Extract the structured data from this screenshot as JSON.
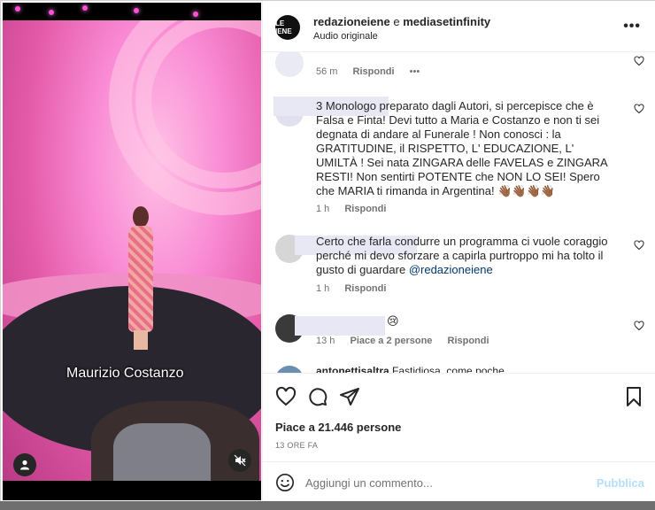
{
  "video": {
    "caption": "Maurizio Costanzo",
    "user_icon": "user-icon",
    "mute_icon": "muted-icon"
  },
  "header": {
    "account1": "redazioneiene",
    "joiner": "e",
    "account2": "mediasetinfinity",
    "subtitle": "Audio originale",
    "avatar_text": "LE IENE"
  },
  "comments": [
    {
      "text": "",
      "meta": [
        "56 m",
        "Rispondi",
        "•••"
      ]
    },
    {
      "text": "3 Monologo preparato dagli Autori, si percepisce che è Falsa e Finta! Devi tutto a Maria e Costanzo e non ti sei degnata di andare al Funerale ! Non conosci : la GRATITUDINE, il RISPETTO, L' EDUCAZIONE, L' UMILTÀ ! Sei nata ZINGARA delle FAVELAS e ZINGARA RESTI! Non sentirti POTENTE che NON LO SEI! Spero che MARIA ti rimanda in Argentina! 👋🏾👋🏾👋🏾👋🏾",
      "meta": [
        "1 h",
        "Rispondi"
      ]
    },
    {
      "text": "Certo che farla condurre un programma ci vuole coraggio perché mi devo sforzare a capirla purtroppo mi ha tolto il gusto di guardare",
      "mention": "@redazioneiene",
      "meta": [
        "1 h",
        "Rispondi"
      ]
    },
    {
      "text": "😢",
      "meta": [
        "13 h",
        "Piace a 2 persone",
        "Rispondi"
      ]
    },
    {
      "text": "Fastidiosa, come poche",
      "user": "antonettisaltra"
    }
  ],
  "actions": {
    "likes": "Piace a 21.446 persone",
    "time": "13 ORE FA"
  },
  "composer": {
    "placeholder": "Aggiungi un commento...",
    "publish": "Pubblica"
  },
  "colors": {
    "link": "#00376b",
    "publish_disabled": "#b2dffc",
    "muted_text": "#737373"
  }
}
